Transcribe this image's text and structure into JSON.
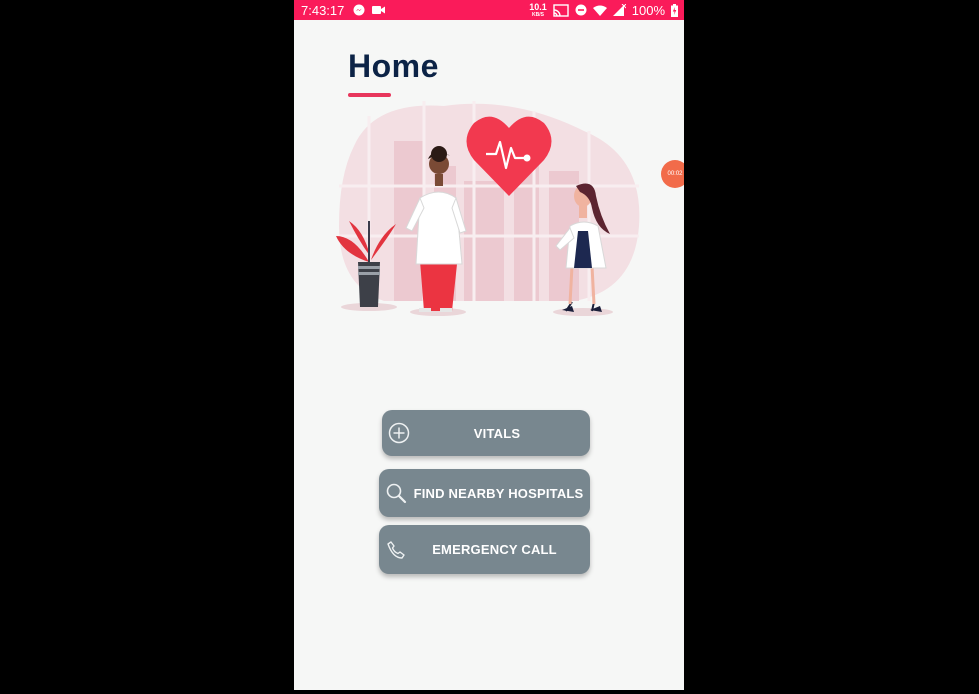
{
  "status_bar": {
    "time": "7:43:17",
    "net_speed_value": "10.1",
    "net_speed_unit": "KB/S",
    "battery": "100%",
    "background": "#fa1b5a"
  },
  "page": {
    "title": "Home",
    "accent_color": "#e8365c",
    "title_color": "#0c2346"
  },
  "floating_badge": {
    "text": "00:02",
    "color": "#f26b4a"
  },
  "actions": [
    {
      "label": "VITALS",
      "icon": "plus-circle-icon"
    },
    {
      "label": "FIND NEARBY HOSPITALS",
      "icon": "search-icon"
    },
    {
      "label": "EMERGENCY CALL",
      "icon": "phone-icon"
    }
  ],
  "button_color": "#78878f"
}
